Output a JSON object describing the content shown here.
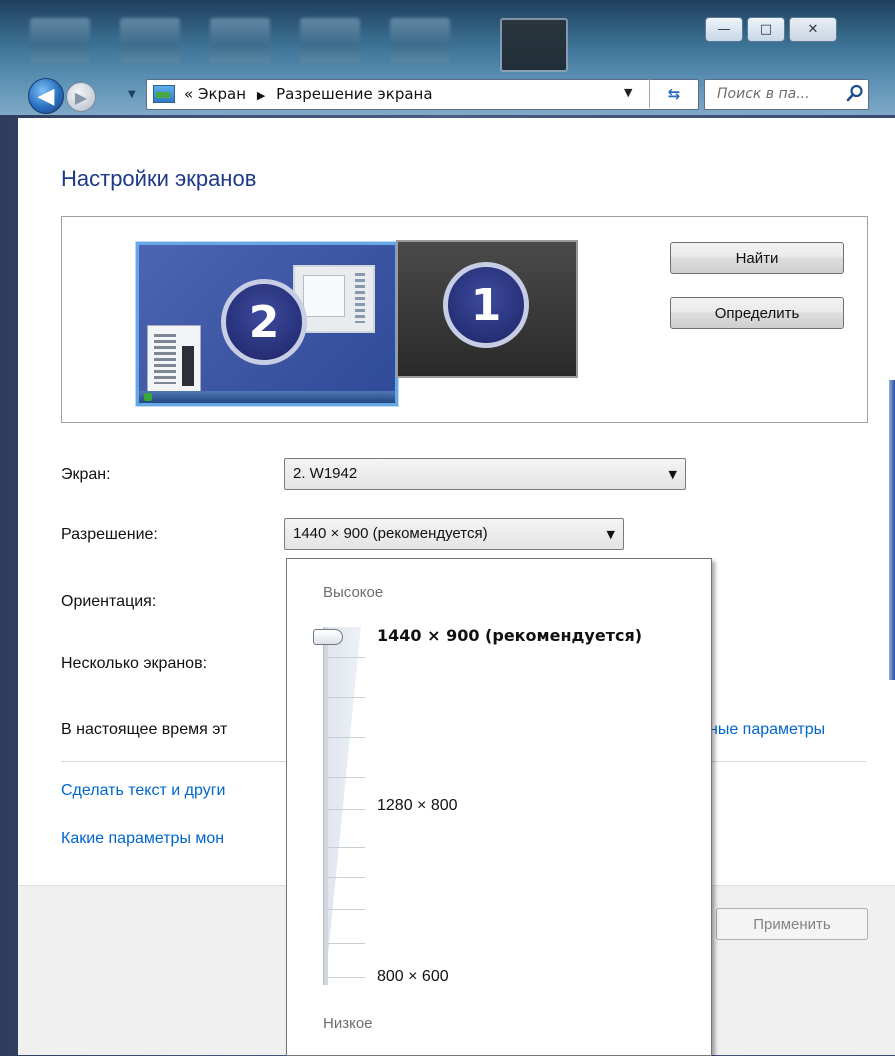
{
  "window": {
    "minimize_glyph": "—",
    "maximize_glyph": "□",
    "close_glyph": "✕"
  },
  "navigation": {
    "back_glyph": "◀",
    "forward_glyph": "▶",
    "history_glyph": "▼"
  },
  "address_bar": {
    "overflow": "«",
    "crumbs": [
      "Экран",
      "Разрешение экрана"
    ],
    "crumb_separator": "▶",
    "dropdown_glyph": "▼",
    "refresh_glyph": "⇆"
  },
  "search": {
    "placeholder": "Поиск в па..."
  },
  "page": {
    "title": "Настройки экранов"
  },
  "monitors": {
    "monitor2_number": "2",
    "monitor1_number": "1",
    "selected": "2",
    "find_button": "Найти",
    "identify_button": "Определить"
  },
  "form": {
    "display_label": "Экран:",
    "display_value": "2. W1942",
    "resolution_label": "Разрешение:",
    "resolution_value": "1440 × 900 (рекомендуется)",
    "orientation_label": "Ориентация:",
    "multiple_label": "Несколько экранов:",
    "current_text_visible": "В настоящее время эт",
    "advanced_link_visible": "ные параметры",
    "text_size_link_visible": "Сделать текст и други",
    "which_settings_link_visible": "Какие параметры мон",
    "apply_button": "Применить",
    "combo_arrow": "▼"
  },
  "resolution_popup": {
    "high_label": "Высокое",
    "low_label": "Низкое",
    "options": [
      {
        "label": "1440 × 900 (рекомендуется)",
        "selected": true
      },
      {
        "label": "1280 × 800",
        "selected": false
      },
      {
        "label": "800 × 600",
        "selected": false
      }
    ],
    "slider_position": "top"
  },
  "colors": {
    "title_blue": "#1e3a87",
    "link_blue": "#0066cc",
    "monitor_selected_border": "#66a8e6",
    "badge_navy": "#1d2566"
  }
}
